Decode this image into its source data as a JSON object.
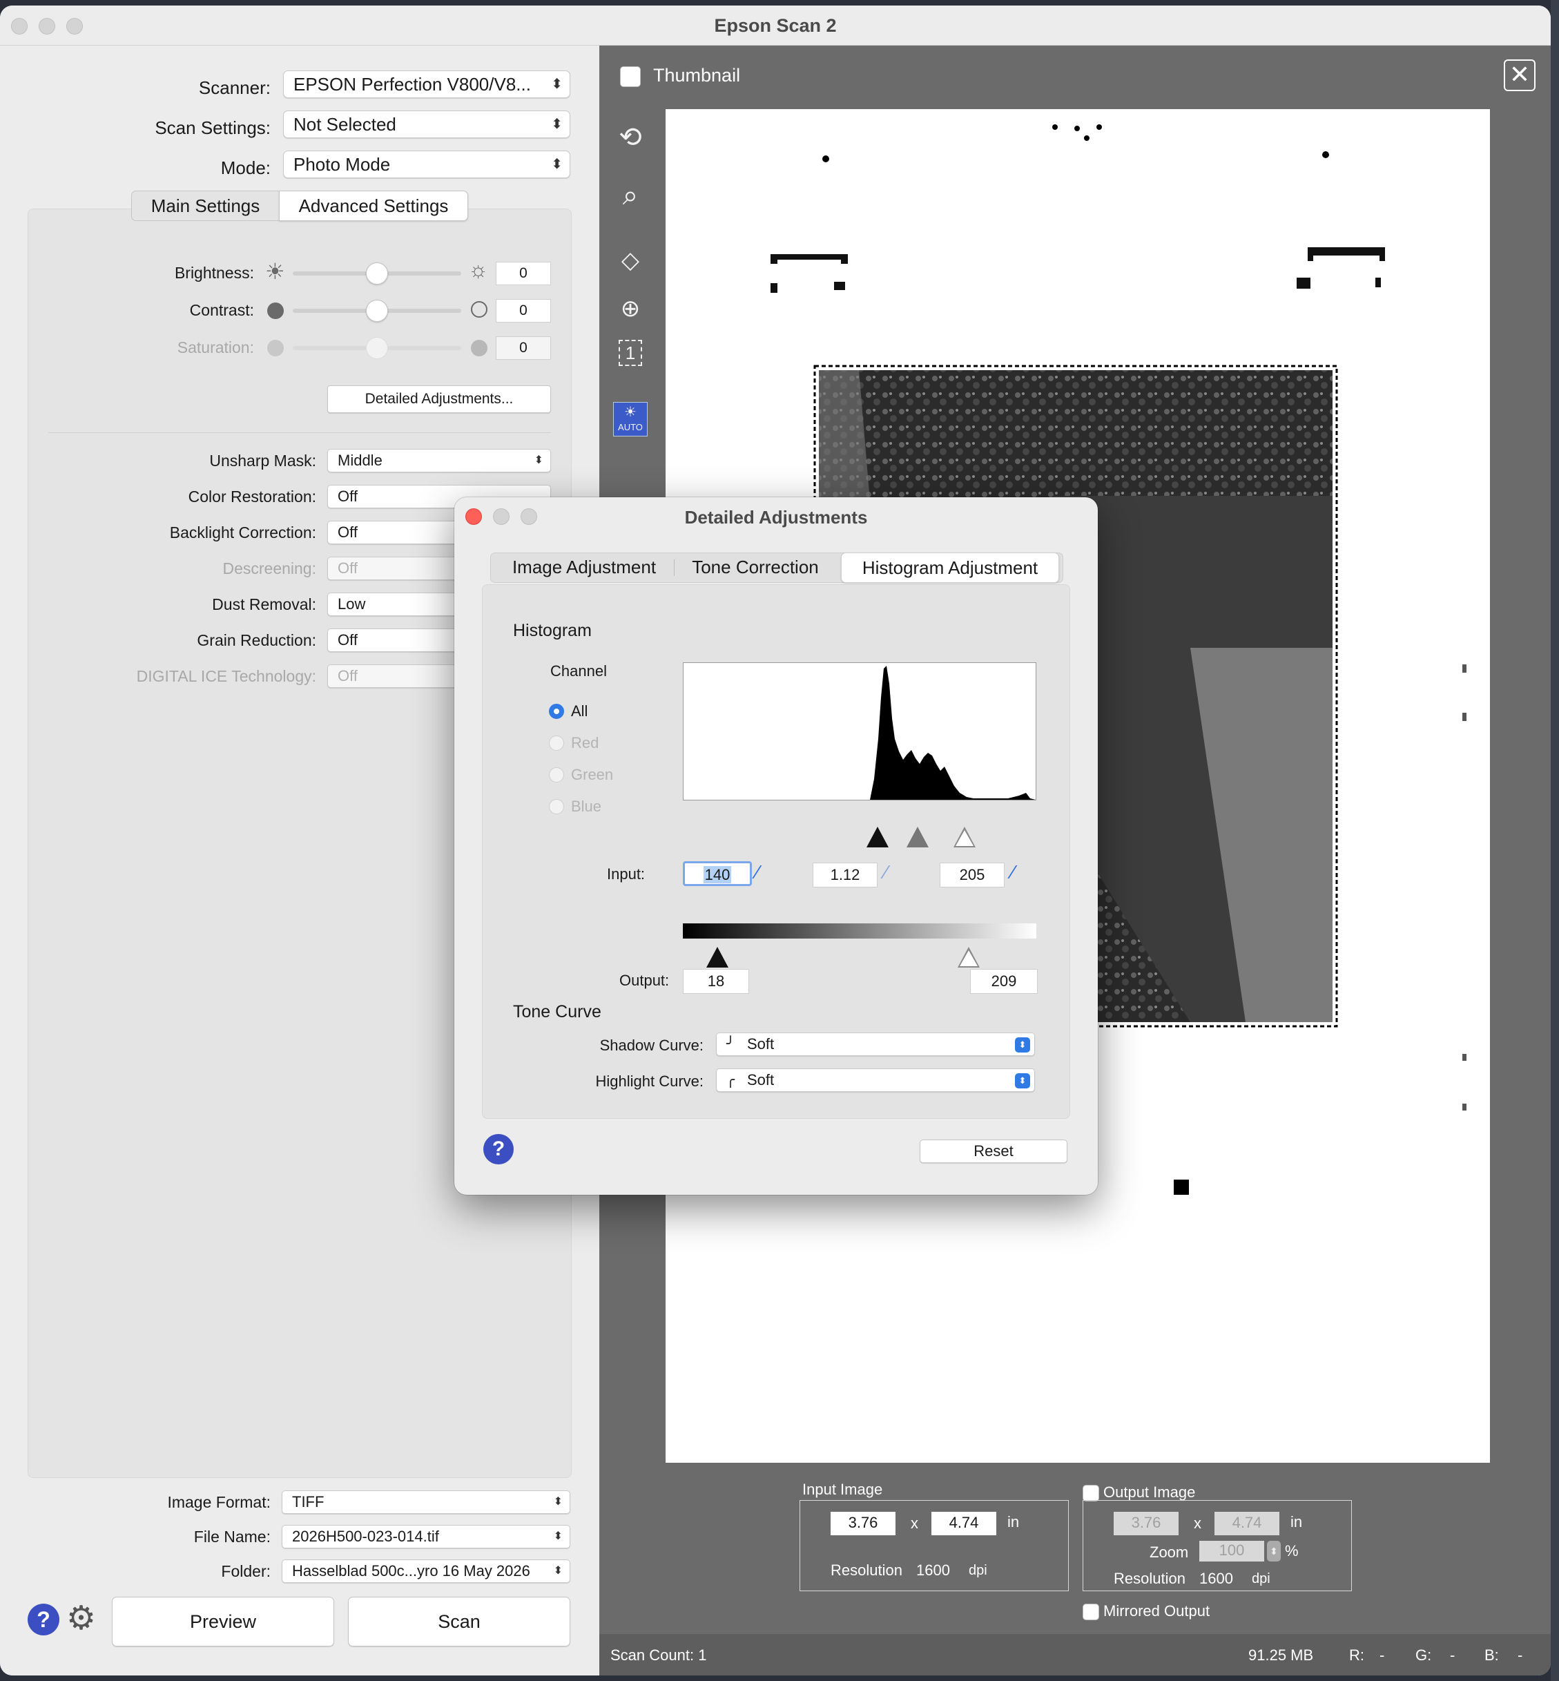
{
  "window": {
    "title": "Epson Scan 2"
  },
  "left": {
    "scanner": {
      "label": "Scanner:",
      "value": "EPSON Perfection V800/V8..."
    },
    "scan_settings": {
      "label": "Scan Settings:",
      "value": "Not Selected"
    },
    "mode": {
      "label": "Mode:",
      "value": "Photo Mode"
    },
    "tabs": {
      "main": "Main Settings",
      "advanced": "Advanced Settings"
    },
    "brightness": {
      "label": "Brightness:",
      "value": "0"
    },
    "contrast": {
      "label": "Contrast:",
      "value": "0"
    },
    "saturation": {
      "label": "Saturation:",
      "value": "0"
    },
    "detailed_button": "Detailed Adjustments...",
    "unsharp": {
      "label": "Unsharp Mask:",
      "value": "Middle"
    },
    "color_restoration": {
      "label": "Color Restoration:",
      "value": "Off"
    },
    "backlight": {
      "label": "Backlight Correction:",
      "value": "Off"
    },
    "descreening": {
      "label": "Descreening:",
      "value": "Off"
    },
    "dust": {
      "label": "Dust Removal:",
      "value": "Low"
    },
    "grain": {
      "label": "Grain Reduction:",
      "value": "Off"
    },
    "ice": {
      "label": "DIGITAL ICE Technology:",
      "value": "Off"
    },
    "image_format": {
      "label": "Image Format:",
      "value": "TIFF"
    },
    "file_name": {
      "label": "File Name:",
      "value": "2026H500-023-014.tif"
    },
    "folder": {
      "label": "Folder:",
      "value": "Hasselblad 500c...yro 16 May 2026"
    },
    "preview_button": "Preview",
    "scan_button": "Scan"
  },
  "right": {
    "thumbnail_label": "Thumbnail",
    "auto_label": "AUTO",
    "input_image": {
      "title": "Input Image",
      "width": "3.76",
      "x": "x",
      "height": "4.74",
      "unit": "in",
      "resolution_label": "Resolution",
      "resolution": "1600",
      "dpi": "dpi"
    },
    "output_image": {
      "title": "Output Image",
      "width": "3.76",
      "x": "x",
      "height": "4.74",
      "unit": "in",
      "zoom_label": "Zoom",
      "zoom": "100",
      "percent": "%",
      "resolution_label": "Resolution",
      "resolution": "1600",
      "dpi": "dpi"
    },
    "mirrored": "Mirrored Output",
    "status": {
      "scan_count": "Scan Count: 1",
      "size": "91.25 MB",
      "r": "R:",
      "r_val": "-",
      "g": "G:",
      "g_val": "-",
      "b": "B:",
      "b_val": "-"
    }
  },
  "dialog": {
    "title": "Detailed Adjustments",
    "tabs": {
      "image": "Image Adjustment",
      "tone": "Tone Correction",
      "histogram": "Histogram Adjustment"
    },
    "histogram_title": "Histogram",
    "channel_label": "Channel",
    "channels": [
      "All",
      "Red",
      "Green",
      "Blue"
    ],
    "input_label": "Input:",
    "input": {
      "black": "140",
      "gamma": "1.12",
      "white": "205"
    },
    "output_label": "Output:",
    "output": {
      "black": "18",
      "white": "209"
    },
    "tone_curve_title": "Tone Curve",
    "shadow": {
      "label": "Shadow Curve:",
      "value": "Soft"
    },
    "highlight": {
      "label": "Highlight Curve:",
      "value": "Soft"
    },
    "reset": "Reset"
  }
}
